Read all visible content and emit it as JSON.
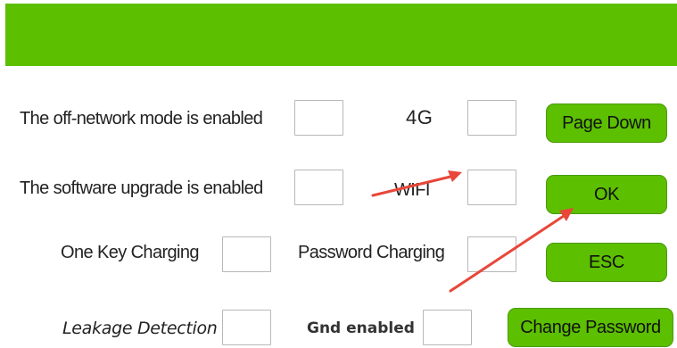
{
  "settings": {
    "off_network_label": "The off-network mode is enabled",
    "software_upgrade_label": "The software upgrade is enabled",
    "one_key_charging_label": "One Key Charging",
    "leakage_detection_label": "Leakage Detection",
    "four_g_label": "4G",
    "wifi_label": "WIFI",
    "password_charging_label": "Password Charging",
    "gnd_enabled_label": "Gnd enabled"
  },
  "buttons": {
    "page_down": "Page Down",
    "ok": "OK",
    "esc": "ESC",
    "change_password": "Change Password"
  },
  "colors": {
    "header": "#5cbf00",
    "button": "#5cbf00",
    "annotation_arrow": "#e8473a"
  }
}
